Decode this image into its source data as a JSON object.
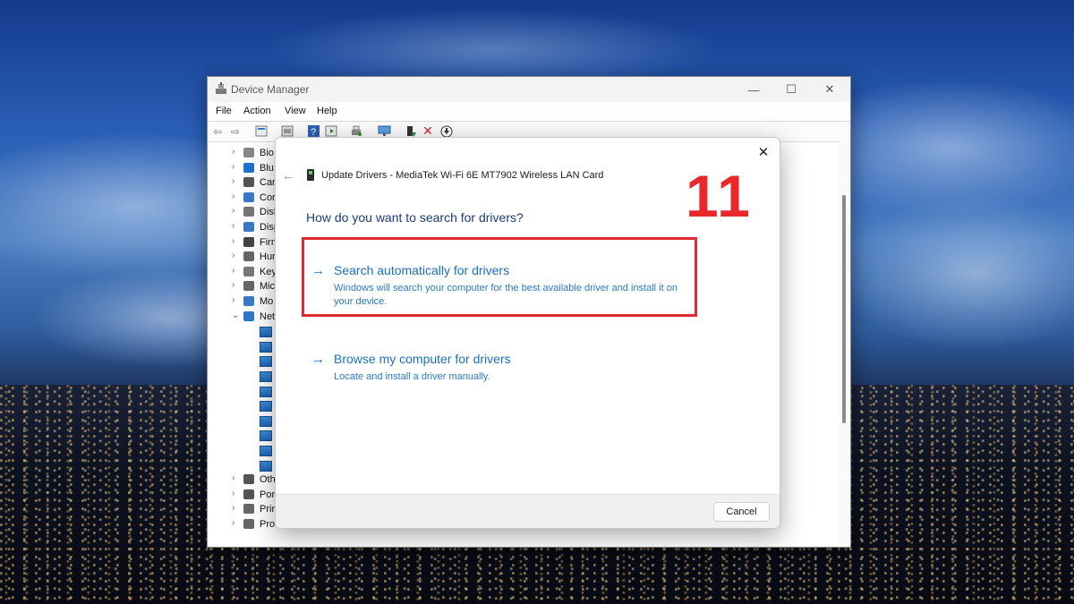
{
  "window": {
    "title": "Device Manager",
    "controls": {
      "minimize": "—",
      "maximize": "☐",
      "close": "✕"
    }
  },
  "menu": [
    "File",
    "Action",
    "View",
    "Help"
  ],
  "toolbar_icons": [
    "back-arrow-icon",
    "forward-arrow-icon",
    "properties-icon",
    "show-hide-icon",
    "help-icon",
    "run-icon",
    "print-icon",
    "monitor-icon",
    "update-driver-icon",
    "uninstall-icon",
    "download-icon"
  ],
  "tree": {
    "items": [
      {
        "label": "Bio",
        "expanded": false,
        "icon": "fingerprint-icon"
      },
      {
        "label": "Blu",
        "expanded": false,
        "icon": "bluetooth-icon"
      },
      {
        "label": "Can",
        "expanded": false,
        "icon": "camera-icon"
      },
      {
        "label": "Cor",
        "expanded": false,
        "icon": "computer-icon"
      },
      {
        "label": "Disk",
        "expanded": false,
        "icon": "disk-icon"
      },
      {
        "label": "Disp",
        "expanded": false,
        "icon": "display-icon"
      },
      {
        "label": "Firm",
        "expanded": false,
        "icon": "firmware-icon"
      },
      {
        "label": "Hur",
        "expanded": false,
        "icon": "hid-icon"
      },
      {
        "label": "Key",
        "expanded": false,
        "icon": "keyboard-icon"
      },
      {
        "label": "Mic",
        "expanded": false,
        "icon": "mouse-icon"
      },
      {
        "label": "Mo",
        "expanded": false,
        "icon": "monitor-icon"
      },
      {
        "label": "Net",
        "expanded": true,
        "icon": "network-icon"
      },
      {
        "label": "Oth",
        "expanded": false,
        "icon": "other-devices-icon"
      },
      {
        "label": "Por",
        "expanded": false,
        "icon": "port-icon"
      },
      {
        "label": "Prin",
        "expanded": false,
        "icon": "printer-icon"
      },
      {
        "label": "Pro",
        "expanded": false,
        "icon": "processor-icon"
      }
    ]
  },
  "dialog": {
    "title": "Update Drivers - MediaTek Wi-Fi 6E MT7902 Wireless LAN Card",
    "step_number": "11",
    "question": "How do you want to search for drivers?",
    "options": [
      {
        "title": "Search automatically for drivers",
        "description": "Windows will search your computer for the best available driver and install it on your device."
      },
      {
        "title": "Browse my computer for drivers",
        "description": "Locate and install a driver manually."
      }
    ],
    "cancel_label": "Cancel",
    "close_glyph": "✕",
    "back_glyph": "←",
    "arrow_glyph": "→"
  },
  "colors": {
    "accent": "#1a6fc0",
    "question": "#1b3d77",
    "highlight": "#e02b2e",
    "step_number": "#e8282a"
  }
}
